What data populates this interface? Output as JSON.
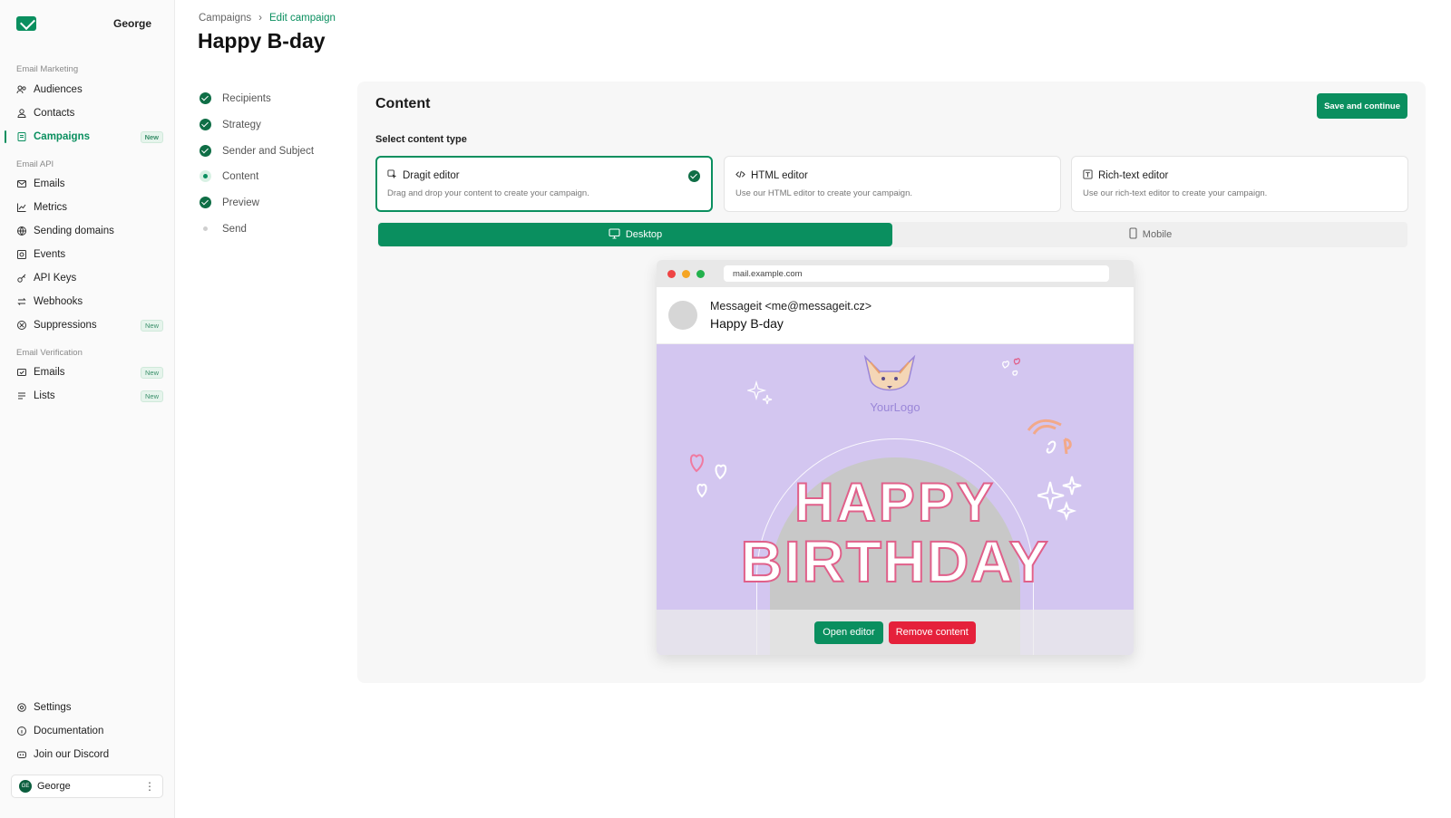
{
  "workspace": {
    "name": "George"
  },
  "sidebar": {
    "sections": [
      {
        "title": "Email Marketing"
      },
      {
        "title": "Email API"
      },
      {
        "title": "Email Verification"
      }
    ],
    "items": [
      {
        "label": "Audiences",
        "icon": "audiences-icon"
      },
      {
        "label": "Contacts",
        "icon": "contacts-icon"
      },
      {
        "label": "Campaigns",
        "icon": "campaigns-icon",
        "badge": "New",
        "active": true
      },
      {
        "label": "Emails",
        "icon": "emails-icon"
      },
      {
        "label": "Metrics",
        "icon": "metrics-icon"
      },
      {
        "label": "Sending domains",
        "icon": "globe-icon"
      },
      {
        "label": "Events",
        "icon": "events-icon"
      },
      {
        "label": "API Keys",
        "icon": "key-icon"
      },
      {
        "label": "Webhooks",
        "icon": "webhooks-icon"
      },
      {
        "label": "Suppressions",
        "icon": "suppressions-icon",
        "badge": "New"
      },
      {
        "label": "Emails",
        "icon": "verify-emails-icon",
        "badge": "New"
      },
      {
        "label": "Lists",
        "icon": "lists-icon",
        "badge": "New"
      },
      {
        "label": "Settings",
        "icon": "gear-icon"
      },
      {
        "label": "Documentation",
        "icon": "docs-icon"
      },
      {
        "label": "Join our Discord",
        "icon": "discord-icon"
      }
    ],
    "user": {
      "initials": "GE",
      "name": "George"
    }
  },
  "header": {
    "breadcrumb": [
      "Campaigns",
      "Edit campaign"
    ],
    "title": "Happy B-day"
  },
  "steps": [
    {
      "label": "Recipients",
      "state": "done"
    },
    {
      "label": "Strategy",
      "state": "done"
    },
    {
      "label": "Sender and Subject",
      "state": "done"
    },
    {
      "label": "Content",
      "state": "current"
    },
    {
      "label": "Preview",
      "state": "done"
    },
    {
      "label": "Send",
      "state": "pending"
    }
  ],
  "content": {
    "title": "Content",
    "save_label": "Save and continue",
    "select_label": "Select content type",
    "types": [
      {
        "title": "Dragit editor",
        "desc": "Drag and drop your content to create your campaign.",
        "selected": true
      },
      {
        "title": "HTML editor",
        "desc": "Use our HTML editor to create your campaign.",
        "selected": false
      },
      {
        "title": "Rich-text editor",
        "desc": "Use our rich-text editor to create your campaign.",
        "selected": false
      }
    ],
    "view_toggle": {
      "desktop": "Desktop",
      "mobile": "Mobile",
      "selected": "Desktop"
    },
    "preview": {
      "url": "mail.example.com",
      "from": "Messageit <me@messageit.cz>",
      "subject": "Happy B-day",
      "logo_text": "YourLogo",
      "banner_line1": "HAPPY",
      "banner_line2": "BIRTHDAY",
      "open_label": "Open editor",
      "remove_label": "Remove content"
    }
  },
  "colors": {
    "accent": "#0a8f5f",
    "danger": "#e5213b",
    "hero_bg": "#d3c6f0"
  }
}
